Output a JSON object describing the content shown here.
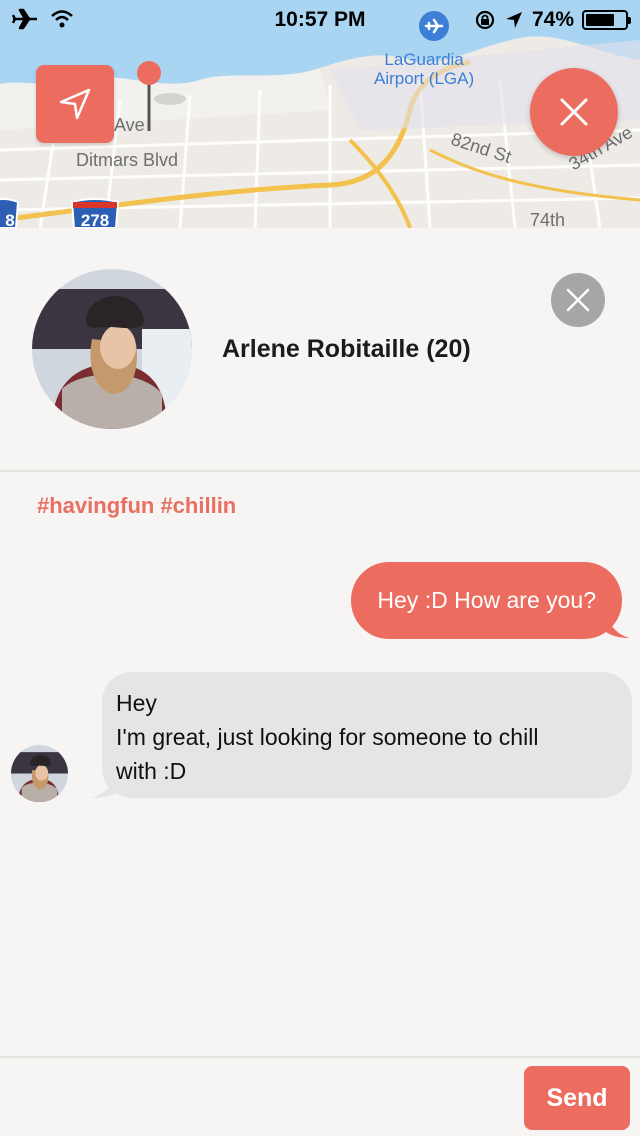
{
  "colors": {
    "accent": "#ec6c5f",
    "accent_text": "#e96f62",
    "incoming_bubble": "#e6e5e3",
    "background": "#f7f5f3"
  },
  "status_bar": {
    "time": "10:57 PM",
    "battery": "74%",
    "battery_level": 0.74
  },
  "map": {
    "airport_line1": "LaGuardia",
    "airport_line2": "Airport (LGA)",
    "street_ditmars": "Ditmars Blvd",
    "street_ave": "Ave",
    "street_82nd": "82nd St",
    "street_34th": "34th Ave",
    "street_74th": "74th",
    "shield_278": "278",
    "shield_partial": "8"
  },
  "profile": {
    "name": "Arlene Robitaille (20)",
    "tags": "#havingfun #chillin"
  },
  "messages": {
    "outgoing": "Hey :D How are you?",
    "incoming_line1": "Hey",
    "incoming_line2": "I'm great, just looking for someone to chill",
    "incoming_line3": "with :D"
  },
  "composer": {
    "placeholder": "",
    "send_label": "Send"
  }
}
